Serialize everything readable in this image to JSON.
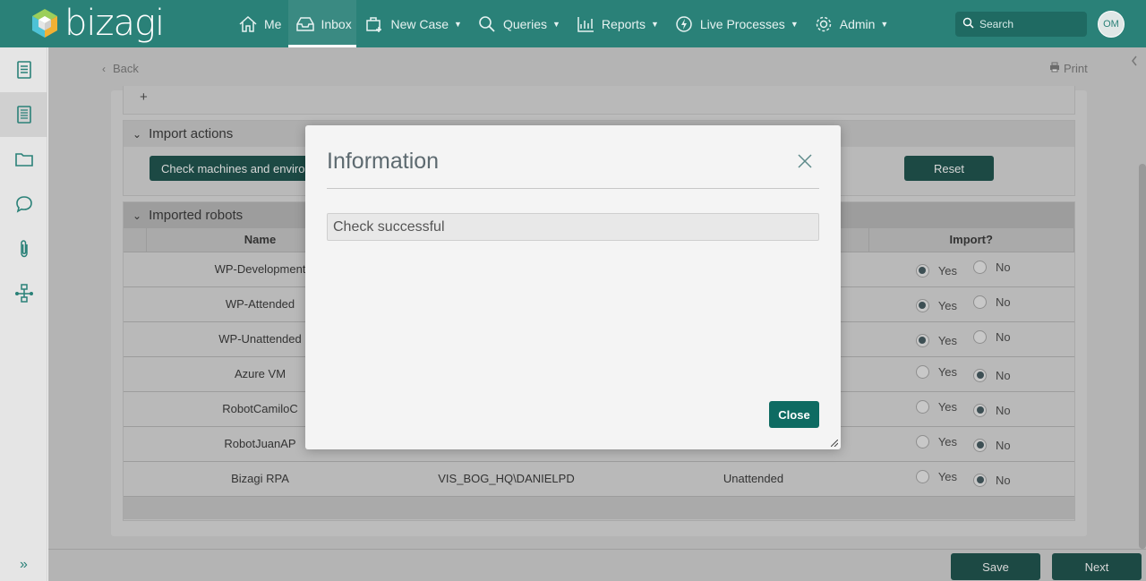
{
  "app": {
    "logo_text": "bizagi",
    "brand_color": "#2a8178"
  },
  "nav": [
    {
      "label": "Me",
      "icon": "home-icon"
    },
    {
      "label": "Inbox",
      "icon": "inbox-icon",
      "active": true
    },
    {
      "label": "New Case",
      "icon": "new-case-icon",
      "dropdown": true
    },
    {
      "label": "Queries",
      "icon": "search-icon",
      "dropdown": true
    },
    {
      "label": "Reports",
      "icon": "chart-icon",
      "dropdown": true
    },
    {
      "label": "Live Processes",
      "icon": "lightning-icon",
      "dropdown": true
    },
    {
      "label": "Admin",
      "icon": "gear-icon",
      "dropdown": true
    }
  ],
  "search": {
    "placeholder": "Search"
  },
  "user": {
    "initials": "OM"
  },
  "page": {
    "back_label": "Back",
    "print_label": "Print"
  },
  "top_panel": {
    "add_label": "+"
  },
  "import_actions": {
    "title": "Import actions",
    "check_label": "Check machines and environ",
    "reset_label": "Reset"
  },
  "imported_robots": {
    "title": "Imported robots",
    "columns": {
      "name": "Name",
      "import": "Import?"
    },
    "yes_label": "Yes",
    "no_label": "No",
    "rows": [
      {
        "name": "WP-Development",
        "machine": "",
        "type": "",
        "import": "yes"
      },
      {
        "name": "WP-Attended",
        "machine": "",
        "type": "",
        "import": "yes"
      },
      {
        "name": "WP-Unattended",
        "machine": "",
        "type": "",
        "import": "yes"
      },
      {
        "name": "Azure VM",
        "machine": "",
        "type": "",
        "import": "no"
      },
      {
        "name": "RobotCamiloC",
        "machine": "",
        "type": "",
        "import": "no"
      },
      {
        "name": "RobotJuanAP",
        "machine": "",
        "type": "",
        "import": "no"
      },
      {
        "name": "Bizagi RPA",
        "machine": "VIS_BOG_HQ\\DANIELPD",
        "type": "Unattended",
        "import": "no"
      }
    ]
  },
  "footer": {
    "save_label": "Save",
    "next_label": "Next"
  },
  "modal": {
    "title": "Information",
    "message": "Check successful",
    "close_label": "Close"
  }
}
